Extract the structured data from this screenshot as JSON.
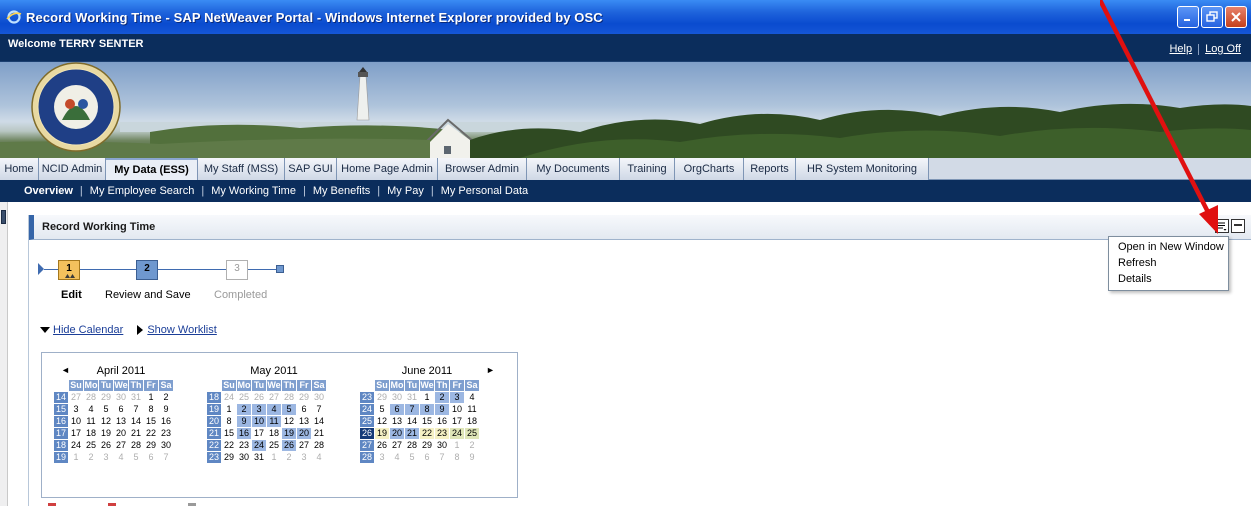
{
  "window": {
    "title": "Record Working Time - SAP NetWeaver Portal - Windows Internet Explorer provided by OSC"
  },
  "header": {
    "welcome": "Welcome TERRY SENTER",
    "help": "Help",
    "logoff": "Log Off"
  },
  "tabs": [
    {
      "label": "Home"
    },
    {
      "label": "NCID Admin"
    },
    {
      "label": "My Data (ESS)"
    },
    {
      "label": "My Staff (MSS)"
    },
    {
      "label": "SAP GUI"
    },
    {
      "label": "Home Page Admin"
    },
    {
      "label": "Browser Admin"
    },
    {
      "label": "My Documents"
    },
    {
      "label": "Training"
    },
    {
      "label": "OrgCharts"
    },
    {
      "label": "Reports"
    },
    {
      "label": "HR System Monitoring"
    }
  ],
  "subnav": [
    {
      "label": "Overview"
    },
    {
      "label": "My Employee Search"
    },
    {
      "label": "My Working Time"
    },
    {
      "label": "My Benefits"
    },
    {
      "label": "My Pay"
    },
    {
      "label": "My Personal Data"
    }
  ],
  "iview": {
    "title": "Record Working Time",
    "menu": [
      {
        "label": "Open in New Window"
      },
      {
        "label": "Refresh"
      },
      {
        "label": "Details"
      }
    ]
  },
  "roadmap": {
    "steps": [
      {
        "num": "1",
        "label": "Edit"
      },
      {
        "num": "2",
        "label": "Review and Save"
      },
      {
        "num": "3",
        "label": "Completed"
      }
    ]
  },
  "links": {
    "hide_calendar": "Hide Calendar",
    "show_worklist": "Show Worklist"
  },
  "calendar": {
    "day_headers": [
      "Su",
      "Mo",
      "Tu",
      "We",
      "Th",
      "Fr",
      "Sa"
    ],
    "months": [
      {
        "title": "April 2011",
        "weeks": [
          {
            "wk": "14",
            "days": [
              [
                "27",
                "o"
              ],
              [
                "28",
                "o"
              ],
              [
                "29",
                "o"
              ],
              [
                "30",
                "o"
              ],
              [
                "31",
                "o"
              ],
              [
                "1",
                "d"
              ],
              [
                "2",
                "d"
              ]
            ]
          },
          {
            "wk": "15",
            "days": [
              [
                "3",
                "d"
              ],
              [
                "4",
                "d"
              ],
              [
                "5",
                "d"
              ],
              [
                "6",
                "d"
              ],
              [
                "7",
                "d"
              ],
              [
                "8",
                "d"
              ],
              [
                "9",
                "d"
              ]
            ]
          },
          {
            "wk": "16",
            "days": [
              [
                "10",
                "d"
              ],
              [
                "11",
                "d"
              ],
              [
                "12",
                "d"
              ],
              [
                "13",
                "d"
              ],
              [
                "14",
                "d"
              ],
              [
                "15",
                "d"
              ],
              [
                "16",
                "d"
              ]
            ]
          },
          {
            "wk": "17",
            "days": [
              [
                "17",
                "d"
              ],
              [
                "18",
                "d"
              ],
              [
                "19",
                "d"
              ],
              [
                "20",
                "d"
              ],
              [
                "21",
                "d"
              ],
              [
                "22",
                "d"
              ],
              [
                "23",
                "d"
              ]
            ]
          },
          {
            "wk": "18",
            "days": [
              [
                "24",
                "d"
              ],
              [
                "25",
                "d"
              ],
              [
                "26",
                "d"
              ],
              [
                "27",
                "d"
              ],
              [
                "28",
                "d"
              ],
              [
                "29",
                "d"
              ],
              [
                "30",
                "d"
              ]
            ]
          },
          {
            "wk": "19",
            "days": [
              [
                "1",
                "o"
              ],
              [
                "2",
                "o"
              ],
              [
                "3",
                "o"
              ],
              [
                "4",
                "o"
              ],
              [
                "5",
                "o"
              ],
              [
                "6",
                "o"
              ],
              [
                "7",
                "o"
              ]
            ]
          }
        ]
      },
      {
        "title": "May 2011",
        "weeks": [
          {
            "wk": "18",
            "days": [
              [
                "24",
                "o"
              ],
              [
                "25",
                "o"
              ],
              [
                "26",
                "o"
              ],
              [
                "27",
                "o"
              ],
              [
                "28",
                "o"
              ],
              [
                "29",
                "o"
              ],
              [
                "30",
                "o"
              ]
            ]
          },
          {
            "wk": "19",
            "days": [
              [
                "1",
                "d"
              ],
              [
                "2",
                "h"
              ],
              [
                "3",
                "h"
              ],
              [
                "4",
                "h"
              ],
              [
                "5",
                "h"
              ],
              [
                "6",
                "d"
              ],
              [
                "7",
                "d"
              ]
            ]
          },
          {
            "wk": "20",
            "days": [
              [
                "8",
                "d"
              ],
              [
                "9",
                "h"
              ],
              [
                "10",
                "h"
              ],
              [
                "11",
                "h"
              ],
              [
                "12",
                "d"
              ],
              [
                "13",
                "d"
              ],
              [
                "14",
                "d"
              ]
            ]
          },
          {
            "wk": "21",
            "days": [
              [
                "15",
                "d"
              ],
              [
                "16",
                "h"
              ],
              [
                "17",
                "d"
              ],
              [
                "18",
                "d"
              ],
              [
                "19",
                "h"
              ],
              [
                "20",
                "h"
              ],
              [
                "21",
                "d"
              ]
            ]
          },
          {
            "wk": "22",
            "days": [
              [
                "22",
                "d"
              ],
              [
                "23",
                "d"
              ],
              [
                "24",
                "h"
              ],
              [
                "25",
                "d"
              ],
              [
                "26",
                "h"
              ],
              [
                "27",
                "d"
              ],
              [
                "28",
                "d"
              ]
            ]
          },
          {
            "wk": "23",
            "days": [
              [
                "29",
                "d"
              ],
              [
                "30",
                "d"
              ],
              [
                "31",
                "d"
              ],
              [
                "1",
                "o"
              ],
              [
                "2",
                "o"
              ],
              [
                "3",
                "o"
              ],
              [
                "4",
                "o"
              ]
            ]
          }
        ]
      },
      {
        "title": "June 2011",
        "weeks": [
          {
            "wk": "23",
            "days": [
              [
                "29",
                "o"
              ],
              [
                "30",
                "o"
              ],
              [
                "31",
                "o"
              ],
              [
                "1",
                "d"
              ],
              [
                "2",
                "h"
              ],
              [
                "3",
                "h"
              ],
              [
                "4",
                "d"
              ]
            ]
          },
          {
            "wk": "24",
            "days": [
              [
                "5",
                "d"
              ],
              [
                "6",
                "h"
              ],
              [
                "7",
                "h"
              ],
              [
                "8",
                "h"
              ],
              [
                "9",
                "h"
              ],
              [
                "10",
                "d"
              ],
              [
                "11",
                "d"
              ]
            ]
          },
          {
            "wk": "25",
            "days": [
              [
                "12",
                "d"
              ],
              [
                "13",
                "d"
              ],
              [
                "14",
                "d"
              ],
              [
                "15",
                "d"
              ],
              [
                "16",
                "d"
              ],
              [
                "17",
                "d"
              ],
              [
                "18",
                "d"
              ]
            ]
          },
          {
            "wk": "26",
            "sel": true,
            "days": [
              [
                "19",
                "p"
              ],
              [
                "20",
                "h"
              ],
              [
                "21",
                "h"
              ],
              [
                "22",
                "p"
              ],
              [
                "23",
                "p"
              ],
              [
                "24",
                "pw"
              ],
              [
                "25",
                "pw"
              ]
            ]
          },
          {
            "wk": "27",
            "days": [
              [
                "26",
                "d"
              ],
              [
                "27",
                "d"
              ],
              [
                "28",
                "d"
              ],
              [
                "29",
                "d"
              ],
              [
                "30",
                "d"
              ],
              [
                "1",
                "o"
              ],
              [
                "2",
                "o"
              ]
            ]
          },
          {
            "wk": "28",
            "days": [
              [
                "3",
                "o"
              ],
              [
                "4",
                "o"
              ],
              [
                "5",
                "o"
              ],
              [
                "6",
                "o"
              ],
              [
                "7",
                "o"
              ],
              [
                "8",
                "o"
              ],
              [
                "9",
                "o"
              ]
            ]
          }
        ]
      }
    ]
  },
  "colors": {
    "titlebar": "#1f64dc",
    "header_bg": "#0b2d5c",
    "tab_bg": "#d2dae6",
    "week_num": "#5f87c3",
    "day_header": "#7f9fcf",
    "step_current": "#f3c15d",
    "annotation_arrow": "#e01010"
  }
}
